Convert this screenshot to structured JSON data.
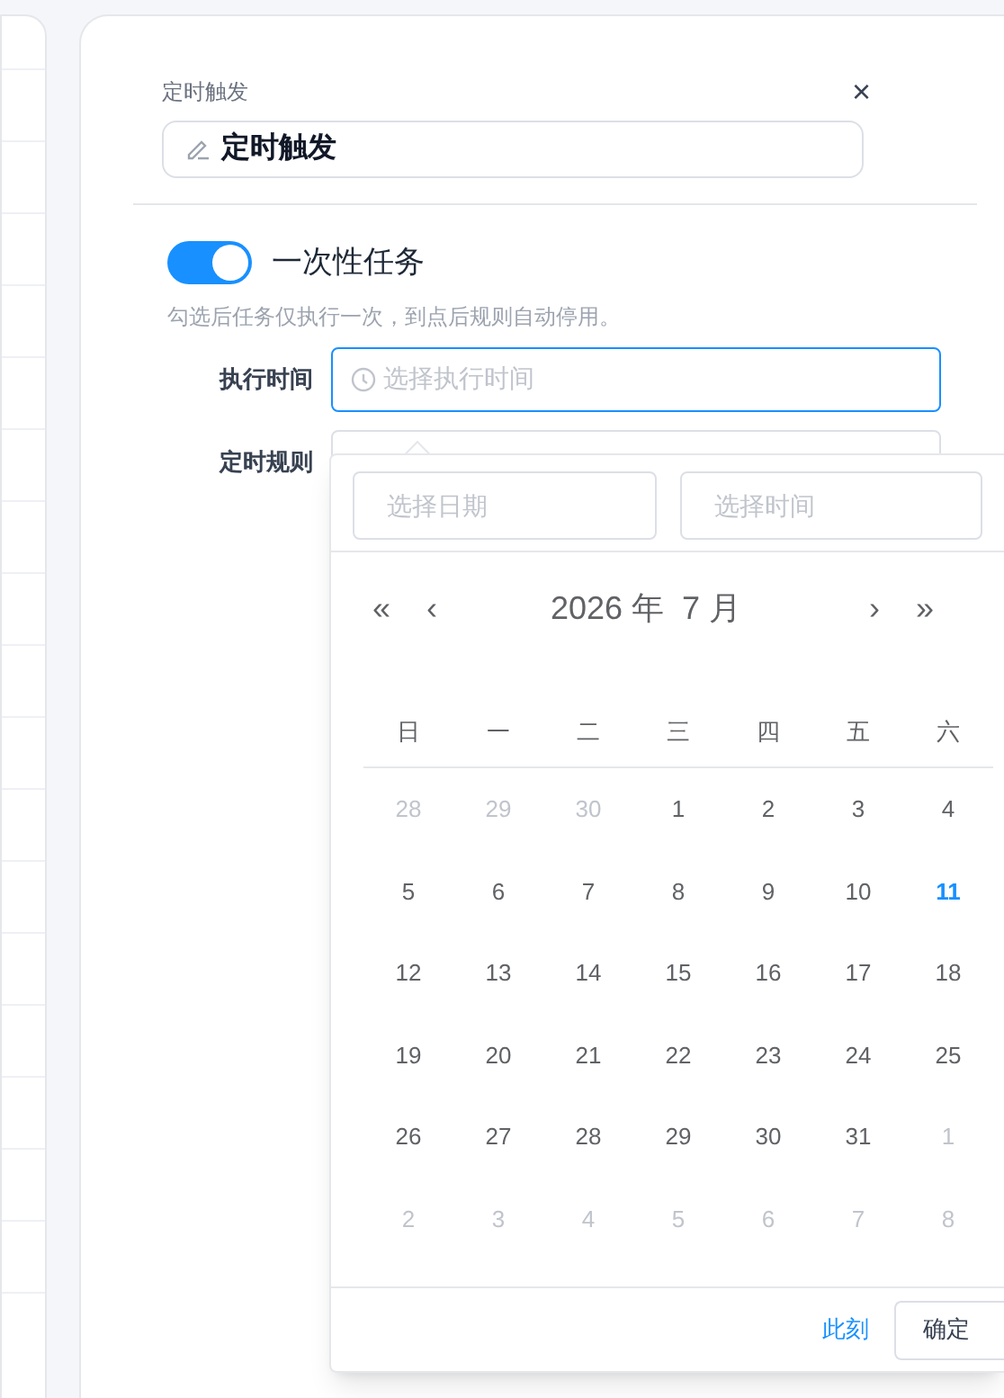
{
  "dialog": {
    "subtitle": "定时触发",
    "close": "×",
    "name_field": {
      "value": "定时触发"
    },
    "one_time": {
      "label": "一次性任务",
      "on": true
    },
    "hint": "勾选后任务仅执行一次，到点后规则自动停用。",
    "fields": [
      {
        "label": "执行时间",
        "placeholder": "选择执行时间",
        "focused": true
      },
      {
        "label": "定时规则",
        "focused": false
      }
    ]
  },
  "picker": {
    "date_field": {
      "placeholder": "选择日期"
    },
    "time_field": {
      "placeholder": "选择时间"
    },
    "nav": {
      "prev_year": "«",
      "prev_month": "‹",
      "title": "2026 年  7 月",
      "next_month": "›",
      "next_year": "»"
    },
    "weekdays": [
      "日",
      "一",
      "二",
      "三",
      "四",
      "五",
      "六"
    ],
    "days": [
      {
        "day": "28",
        "kind": "other"
      },
      {
        "day": "29",
        "kind": "other"
      },
      {
        "day": "30",
        "kind": "other"
      },
      {
        "day": "1",
        "kind": "current"
      },
      {
        "day": "2",
        "kind": "current"
      },
      {
        "day": "3",
        "kind": "current"
      },
      {
        "day": "4",
        "kind": "current"
      },
      {
        "day": "5",
        "kind": "current"
      },
      {
        "day": "6",
        "kind": "current"
      },
      {
        "day": "7",
        "kind": "current"
      },
      {
        "day": "8",
        "kind": "current"
      },
      {
        "day": "9",
        "kind": "current"
      },
      {
        "day": "10",
        "kind": "current"
      },
      {
        "day": "11",
        "kind": "today"
      },
      {
        "day": "12",
        "kind": "current"
      },
      {
        "day": "13",
        "kind": "current"
      },
      {
        "day": "14",
        "kind": "current"
      },
      {
        "day": "15",
        "kind": "current"
      },
      {
        "day": "16",
        "kind": "current"
      },
      {
        "day": "17",
        "kind": "current"
      },
      {
        "day": "18",
        "kind": "current"
      },
      {
        "day": "19",
        "kind": "current"
      },
      {
        "day": "20",
        "kind": "current"
      },
      {
        "day": "21",
        "kind": "current"
      },
      {
        "day": "22",
        "kind": "current"
      },
      {
        "day": "23",
        "kind": "current"
      },
      {
        "day": "24",
        "kind": "current"
      },
      {
        "day": "25",
        "kind": "current"
      },
      {
        "day": "26",
        "kind": "current"
      },
      {
        "day": "27",
        "kind": "current"
      },
      {
        "day": "28",
        "kind": "current"
      },
      {
        "day": "29",
        "kind": "current"
      },
      {
        "day": "30",
        "kind": "current"
      },
      {
        "day": "31",
        "kind": "current"
      },
      {
        "day": "1",
        "kind": "other"
      },
      {
        "day": "2",
        "kind": "other"
      },
      {
        "day": "3",
        "kind": "other"
      },
      {
        "day": "4",
        "kind": "other"
      },
      {
        "day": "5",
        "kind": "other"
      },
      {
        "day": "6",
        "kind": "other"
      },
      {
        "day": "7",
        "kind": "other"
      },
      {
        "day": "8",
        "kind": "other"
      }
    ],
    "now_link": "此刻",
    "confirm": "确定"
  }
}
